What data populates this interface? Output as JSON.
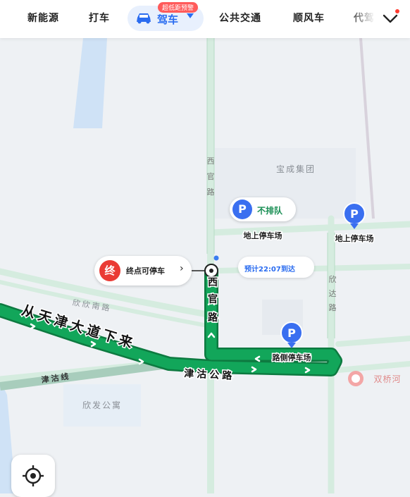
{
  "tabs": {
    "items": [
      "新能源",
      "打车",
      "公共交通",
      "顺风车",
      "代驾"
    ],
    "active": "驾车",
    "promo_badge": "超低距预警"
  },
  "map": {
    "routes": {
      "start_road_label": "从天津大道下来",
      "main_road_label": "津沽公路",
      "xiguan_road_label": "西官路",
      "xiguan_road_vertical": [
        "西",
        "官",
        "路"
      ]
    },
    "roads": {
      "xiguan_north": [
        "西",
        "官",
        "路"
      ],
      "xinda_road": [
        "欣",
        "达",
        "路"
      ],
      "xinxin_road": "欣欣南路",
      "jingu_line": "津沽线"
    },
    "areas": {
      "baocheng": "宝成集团",
      "xinfa": "欣发公寓",
      "shuangqiao": "双桥河"
    },
    "parking": {
      "no_queue": "不排队",
      "ground_lot_1": "地上停车场",
      "ground_lot_2": "地上停车场",
      "roadside": "路侧停车场",
      "p_symbol": "P"
    },
    "destination": {
      "badge": "终",
      "text": "终点可停车",
      "chevron": "›"
    },
    "eta": "预计22:07到达",
    "colors": {
      "route": "#12a65a",
      "route_outline": "#0d7a40",
      "road_secondary": "#d5ecdf",
      "water": "#cfe2f6",
      "parking_blue": "#3a6ff0",
      "dest_red": "#ea3b35",
      "accent_blue": "#2a6cf0"
    }
  }
}
